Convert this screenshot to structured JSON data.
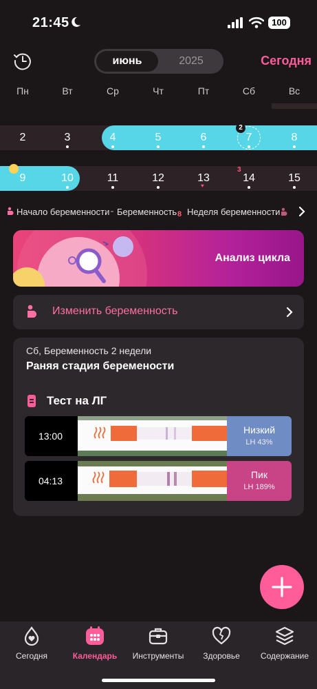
{
  "status_bar": {
    "time": "21:45",
    "battery": "100"
  },
  "header": {
    "month": "июнь",
    "year": "2025",
    "today_link": "Сегодня"
  },
  "weekdays": [
    "Пн",
    "Вт",
    "Ср",
    "Чт",
    "Пт",
    "Сб",
    "Вс"
  ],
  "calendar": {
    "week1": [
      "2",
      "3",
      "4",
      "5",
      "6",
      "7",
      "8"
    ],
    "week1_badge": "2",
    "week2": [
      "9",
      "10",
      "11",
      "12",
      "13",
      "14",
      "15"
    ],
    "week2_mark": "3"
  },
  "legend": {
    "items": [
      "Начало беременности",
      "Беременность",
      "Неделя беременности"
    ],
    "week_marker": "8"
  },
  "banner": {
    "title": "Анализ цикла"
  },
  "change_pregnancy": {
    "label": "Изменить беременность"
  },
  "day_card": {
    "subtitle": "Сб, Беременность 2 недели",
    "heading": "Раняя стадия беремености",
    "section_title": "Тест на ЛГ",
    "tests": [
      {
        "time": "13:00",
        "result": "Низкий",
        "value": "LH 43%"
      },
      {
        "time": "04:13",
        "result": "Пик",
        "value": "LH 189%"
      }
    ]
  },
  "tabs": [
    {
      "label": "Сегодня",
      "icon": "drop-heart-icon",
      "active": false
    },
    {
      "label": "Календарь",
      "icon": "calendar-icon",
      "active": true
    },
    {
      "label": "Инструменты",
      "icon": "toolbox-icon",
      "active": false
    },
    {
      "label": "Здоровье",
      "icon": "heart-icon",
      "active": false
    },
    {
      "label": "Содержание",
      "icon": "layers-icon",
      "active": false
    }
  ],
  "colors": {
    "accent": "#ff5c9a",
    "pregnancy_band": "#57d6e8",
    "low_result": "#6f8cc5",
    "peak_result": "#c94486"
  }
}
